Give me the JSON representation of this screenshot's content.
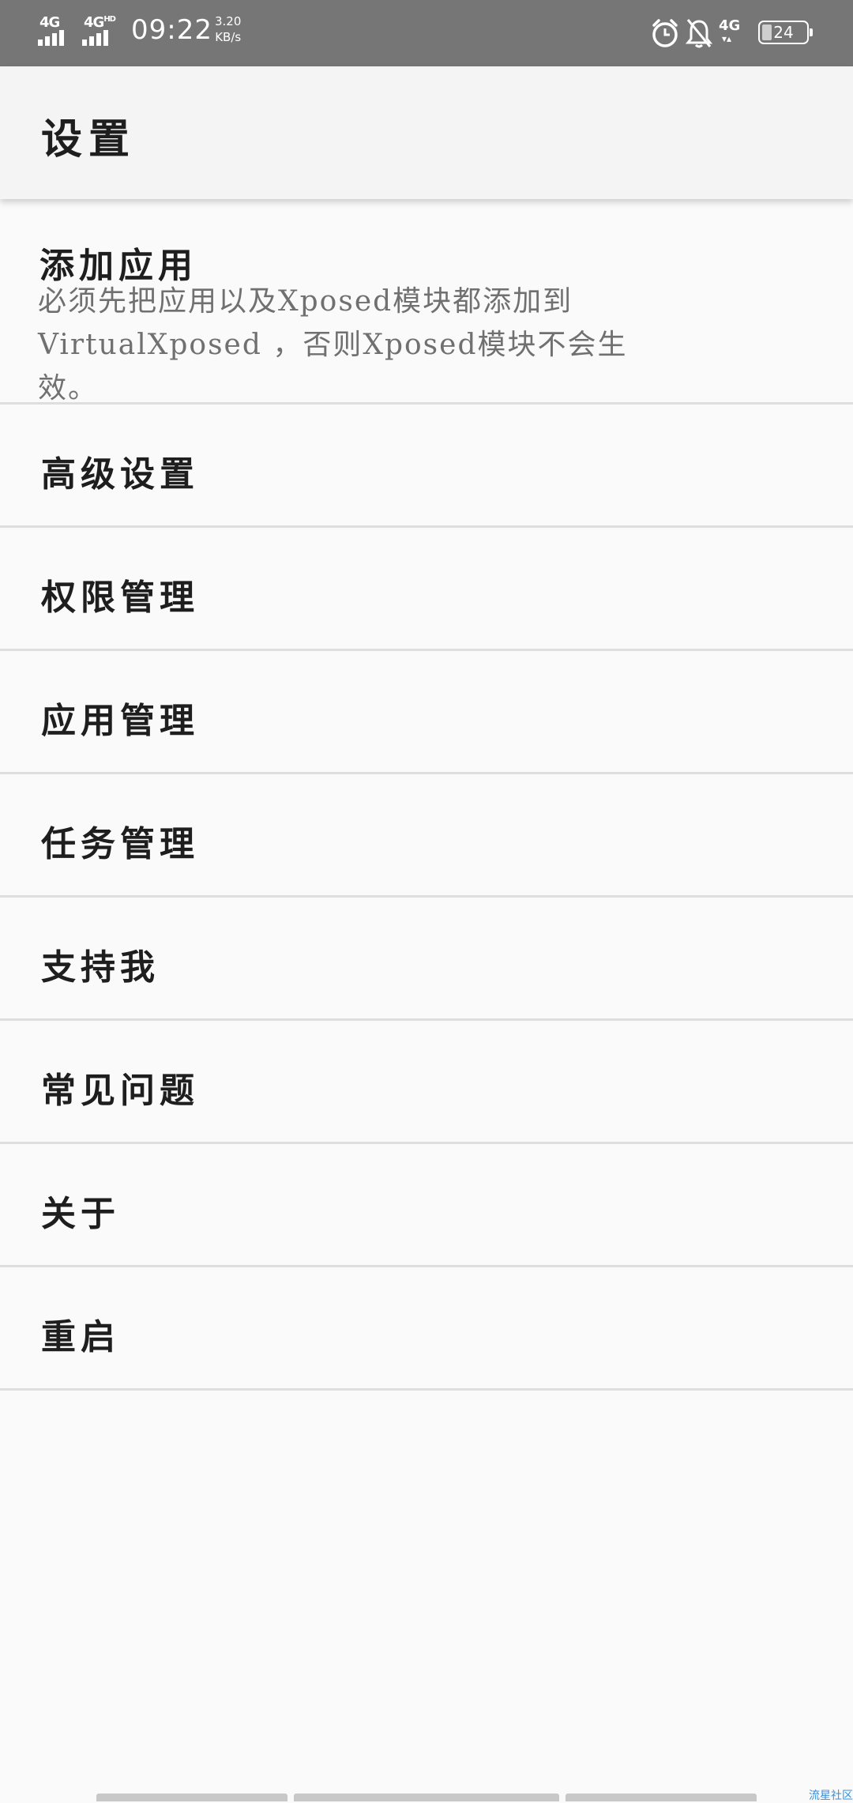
{
  "status_bar": {
    "network1": "4G",
    "network2": "4G",
    "network2_sup": "HD",
    "time": "09:22",
    "speed_value": "3.20",
    "speed_unit": "KB/s",
    "network3": "4G",
    "battery_level": "24",
    "icons": [
      "signal-icon",
      "signal-hd-icon",
      "alarm-icon",
      "notifications-off-icon",
      "data-icon",
      "battery-icon"
    ]
  },
  "app_bar": {
    "title": "设置"
  },
  "settings": {
    "add_app": {
      "title": "添加应用",
      "summary": "必须先把应用以及Xposed模块都添加到VirtualXposed ，否则Xposed模块不会生效。"
    },
    "items": [
      {
        "label": "高级设置"
      },
      {
        "label": "权限管理"
      },
      {
        "label": "应用管理"
      },
      {
        "label": "任务管理"
      },
      {
        "label": "支持我"
      },
      {
        "label": "常见问题"
      },
      {
        "label": "关于"
      },
      {
        "label": "重启"
      }
    ]
  },
  "watermark": "流星社区",
  "colors": {
    "status_bar_bg": "#767676",
    "app_bar_bg": "#f4f4f4",
    "page_bg": "#fafafa",
    "divider": "#dedede",
    "title_text": "#1e1e1e",
    "summary_text": "#707070"
  }
}
